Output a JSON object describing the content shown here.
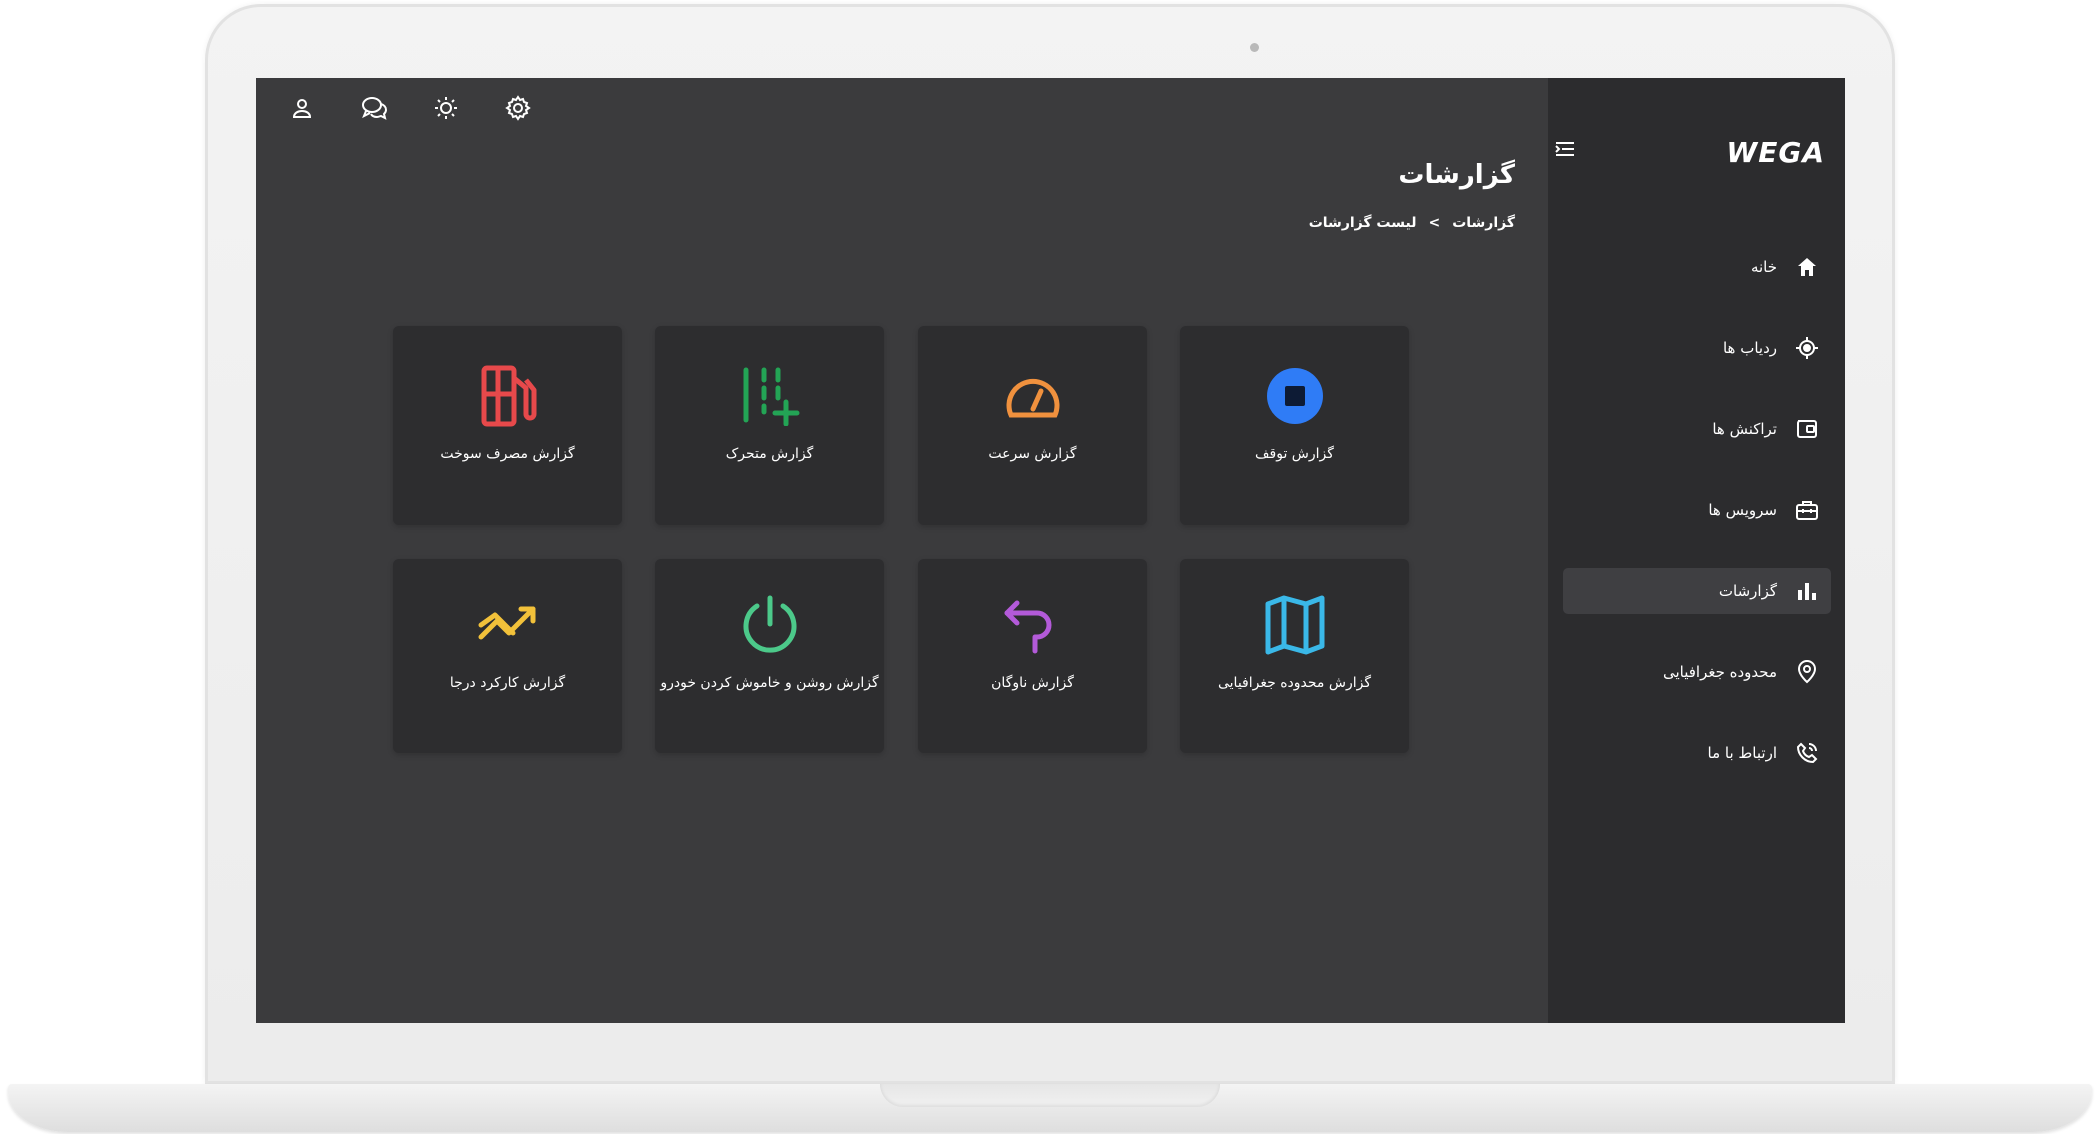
{
  "app": {
    "logo_text": "WEGA"
  },
  "page": {
    "title": "گزارشات",
    "breadcrumb": [
      "گزارشات",
      ">",
      "لیست گزارشات"
    ]
  },
  "sidebar": {
    "items": [
      {
        "label": "خانه",
        "icon": "home-icon",
        "active": false
      },
      {
        "label": "ردیاب ها",
        "icon": "target-icon",
        "active": false
      },
      {
        "label": "تراکنش ها",
        "icon": "wallet-icon",
        "active": false
      },
      {
        "label": "سرویس ها",
        "icon": "toolbox-icon",
        "active": false
      },
      {
        "label": "گزارشات",
        "icon": "bar-chart-icon",
        "active": true
      },
      {
        "label": "محدوده جغرافیایی",
        "icon": "map-pin-icon",
        "active": false
      },
      {
        "label": "ارتباط با ما",
        "icon": "phone-icon",
        "active": false
      }
    ]
  },
  "topbar": {
    "icons": [
      "user-icon",
      "chat-icon",
      "brightness-icon",
      "settings-icon"
    ]
  },
  "reports": {
    "cards": [
      {
        "label": "گزارش توقف",
        "icon": "stop-icon",
        "color": "#2f7cf6"
      },
      {
        "label": "گزارش سرعت",
        "icon": "speedometer-icon",
        "color": "#f0913e"
      },
      {
        "label": "گزارش متحرک",
        "icon": "moving-icon",
        "color": "#23a455"
      },
      {
        "label": "گزارش مصرف سوخت",
        "icon": "fuel-icon",
        "color": "#e7494b"
      },
      {
        "label": "گزارش محدوده جغرافیایی",
        "icon": "map-icon",
        "color": "#3ab8e8"
      },
      {
        "label": "گزارش ناوگان",
        "icon": "route-icon",
        "color": "#b35ad9"
      },
      {
        "label": "گزارش روشن و خاموش کردن خودرو",
        "icon": "power-icon",
        "color": "#4cc98a"
      },
      {
        "label": "گزارش کارکرد درجا",
        "icon": "trend-icon",
        "color": "#f2c13a"
      }
    ]
  },
  "colors": {
    "screen_bg": "#3b3b3d",
    "sidebar_bg": "#2c2c2e",
    "card_bg": "#2d2d2f",
    "active_item_bg": "#3f3f42"
  }
}
